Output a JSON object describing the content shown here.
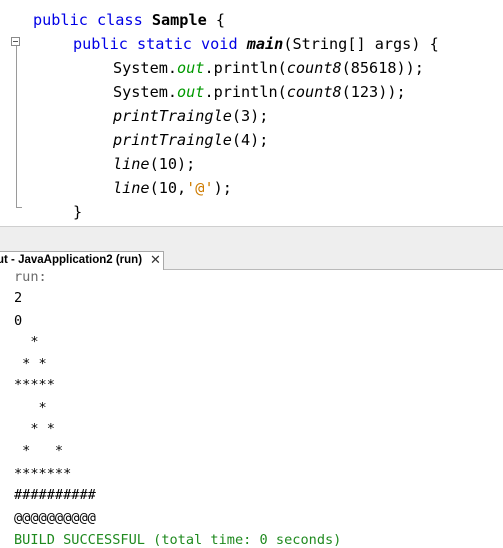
{
  "editor": {
    "lines": {
      "l1": {
        "kw": "public class ",
        "cls": "Sample",
        "rest": " {"
      },
      "l2": {
        "kw": "public static void ",
        "mth": "main",
        "rest": "(String[] args) {"
      },
      "l3": {
        "a": "System.",
        "fld": "out",
        "b": ".println(",
        "it": "count8",
        "c": "(85618));"
      },
      "l4": {
        "a": "System.",
        "fld": "out",
        "b": ".println(",
        "it": "count8",
        "c": "(123));"
      },
      "l5": {
        "it": "printTraingle",
        "c": "(3);"
      },
      "l6": {
        "it": "printTraingle",
        "c": "(4);"
      },
      "l7": {
        "it": "line",
        "c": "(10);"
      },
      "l8": {
        "it": "line",
        "a": "(10,",
        "str": "'@'",
        "c": ");"
      },
      "l9": {
        "text": "}"
      }
    }
  },
  "output_tab": {
    "title": "ut - JavaApplication2 (run)",
    "close": "✕"
  },
  "output": {
    "run": "run:",
    "lines": [
      "2",
      "0",
      "  *",
      " * *",
      "*****",
      "   *",
      "  * *",
      " *   *",
      "*******",
      "##########",
      "@@@@@@@@@@"
    ],
    "build": "BUILD SUCCESSFUL (total time: 0 seconds)"
  }
}
